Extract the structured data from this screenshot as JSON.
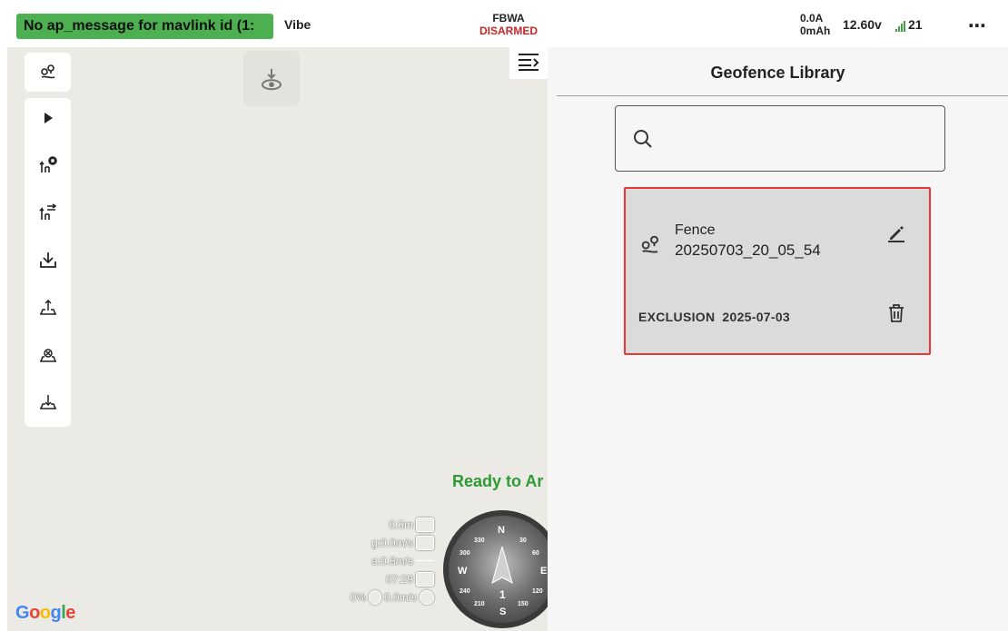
{
  "status_bar": {
    "message": "No ap_message for mavlink id (1:",
    "vibe": "Vibe",
    "flight_mode": "FBWA",
    "arm_state": "DISARMED",
    "current": "0.0A",
    "consumed": "0mAh",
    "voltage": "12.60v",
    "signal": "21",
    "more_icon": "⋯"
  },
  "map": {
    "ready_text": "Ready to Ar",
    "telemetry": {
      "altitude": "0.0m",
      "ground_speed": "g:0.0m/s",
      "air_speed": "a:0.8m/s",
      "time": "07:29",
      "throttle": "0%",
      "climb": "0.0m/s"
    },
    "compass": {
      "n": "N",
      "e": "E",
      "s": "S",
      "w": "W",
      "t30": "30",
      "t60": "60",
      "t120": "120",
      "t150": "150",
      "t210": "210",
      "t240": "240",
      "t300": "300",
      "t330": "330",
      "center": "1"
    },
    "google_logo": {
      "g1": "G",
      "o1": "o",
      "o2": "o",
      "g2": "g",
      "l": "l",
      "e": "e"
    }
  },
  "panel": {
    "title": "Geofence Library",
    "search_placeholder": "",
    "fences": [
      {
        "name": "Fence",
        "id": "20250703_20_05_54",
        "type": "EXCLUSION",
        "date": "2025-07-03"
      }
    ]
  },
  "colors": {
    "ok_green": "#4caf50",
    "ready_green": "#2e9a33",
    "disarmed_red": "#c62828",
    "selection_red": "#e53935",
    "map_bg": "#ebeae4",
    "panel_bg": "#f7f6f7"
  }
}
